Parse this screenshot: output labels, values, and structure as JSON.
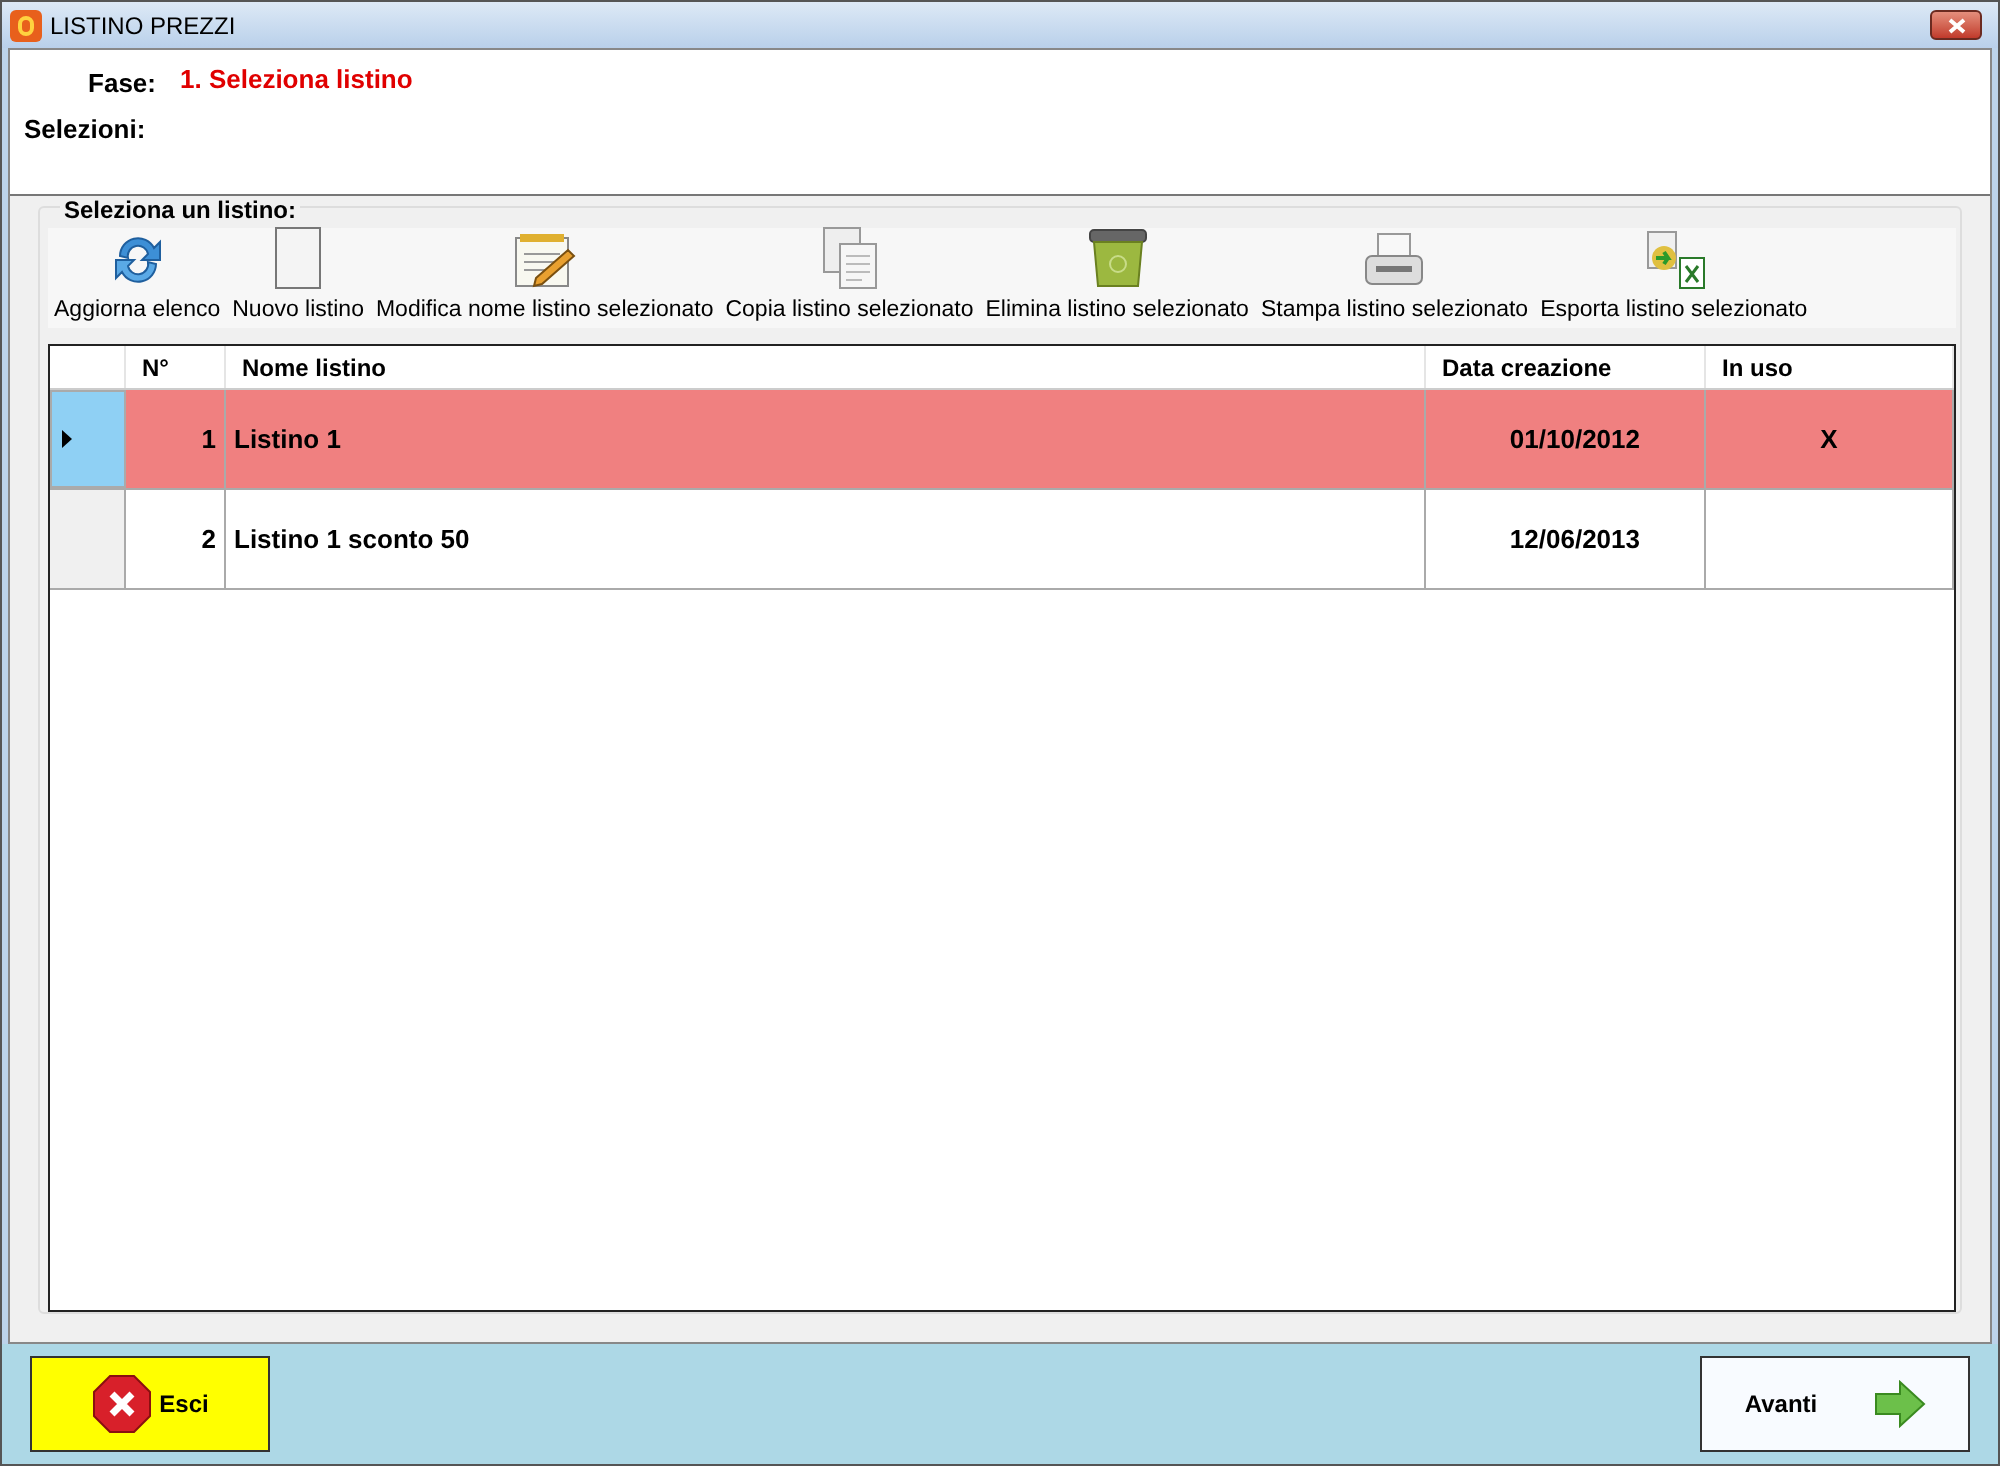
{
  "window": {
    "title": "LISTINO PREZZI"
  },
  "header": {
    "fase_label": "Fase:",
    "fase_value": "1. Seleziona listino",
    "selezioni_label": "Selezioni:"
  },
  "group": {
    "title": "Seleziona un listino:"
  },
  "toolbar": [
    {
      "kind": "refresh",
      "label": "Aggiorna elenco"
    },
    {
      "kind": "new",
      "label": "Nuovo listino"
    },
    {
      "kind": "edit",
      "label": "Modifica nome listino selezionato"
    },
    {
      "kind": "copy",
      "label": "Copia listino selezionato"
    },
    {
      "kind": "delete",
      "label": "Elimina listino selezionato"
    },
    {
      "kind": "print",
      "label": "Stampa listino selezionato"
    },
    {
      "kind": "export",
      "label": "Esporta listino selezionato"
    }
  ],
  "table": {
    "columns": [
      "N°",
      "Nome listino",
      "Data creazione",
      "In uso"
    ],
    "rows": [
      {
        "selected": true,
        "cells": [
          "1",
          "Listino 1",
          "01/10/2012",
          "X"
        ]
      },
      {
        "selected": false,
        "cells": [
          "2",
          "Listino 1 sconto 50",
          "12/06/2013",
          ""
        ]
      }
    ]
  },
  "footer": {
    "exit": "Esci",
    "next": "Avanti"
  }
}
